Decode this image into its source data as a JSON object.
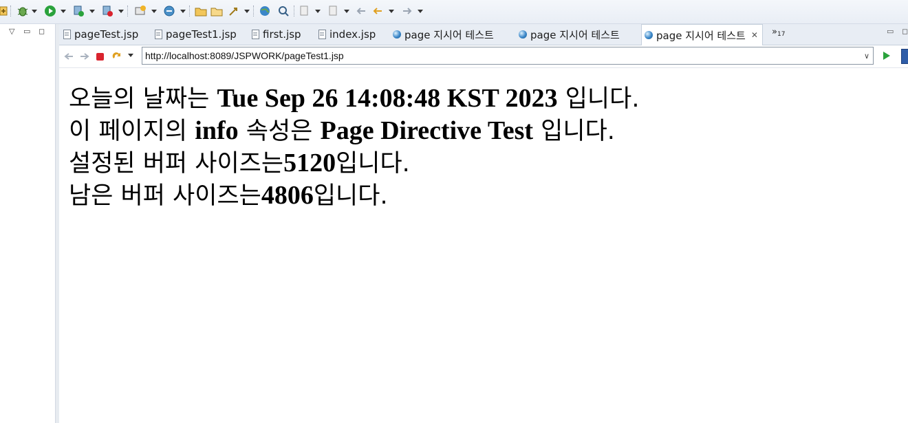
{
  "toolbar": {
    "icons": [
      "external-tool-icon",
      "debug-icon",
      "run-icon",
      "run-server-icon",
      "coverage-icon",
      "new-server-icon",
      "web-services-icon",
      "open-folder-icon",
      "open-file-icon",
      "deploy-icon",
      "globe-icon",
      "search-icon",
      "last-edit-icon",
      "annotation-icon",
      "back-nav-icon",
      "forward-nav-icon"
    ]
  },
  "tabs": [
    {
      "label": "pageTest.jsp",
      "icon": "file-icon",
      "active": false
    },
    {
      "label": "pageTest1.jsp",
      "icon": "file-icon",
      "active": false
    },
    {
      "label": "first.jsp",
      "icon": "file-icon",
      "active": false
    },
    {
      "label": "index.jsp",
      "icon": "file-icon",
      "active": false
    },
    {
      "label": "page 지시어 테스트",
      "icon": "globe-icon",
      "active": false
    },
    {
      "label": "page 지시어 테스트",
      "icon": "globe-icon",
      "active": false
    },
    {
      "label": "page 지시어 테스트",
      "icon": "globe-icon",
      "active": true
    }
  ],
  "overflow": {
    "symbol": "»",
    "count": "17"
  },
  "browser": {
    "url": "http://localhost:8089/JSPWORK/pageTest1.jsp"
  },
  "content": {
    "line1": {
      "pre": "오늘의 날짜는 ",
      "bold": "Tue Sep 26 14:08:48 KST 2023",
      "post": " 입니다."
    },
    "line2": {
      "pre": "이 페이지의 ",
      "bold1": "info",
      "mid": " 속성은 ",
      "bold2": "Page Directive Test",
      "post": " 입니다."
    },
    "line3": {
      "pre": "설정된 버퍼 사이즈는",
      "bold": "5120",
      "post": "입니다."
    },
    "line4": {
      "pre": "남은 버퍼 사이즈는",
      "bold": "4806",
      "post": "입니다."
    }
  },
  "colors": {
    "accent": "#3a86c8",
    "go": "#2aa23c",
    "stop": "#d9232e"
  }
}
